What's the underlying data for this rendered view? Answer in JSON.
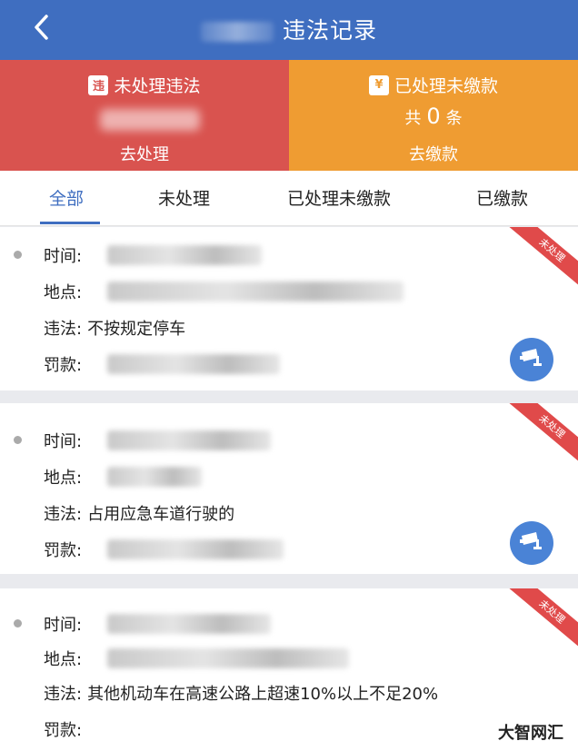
{
  "header": {
    "title": "违法记录"
  },
  "summary": {
    "unprocessed": {
      "icon_text": "违",
      "label": "未处理违法",
      "action": "去处理"
    },
    "processed_unpaid": {
      "icon_text": "¥",
      "label": "已处理未缴款",
      "count_prefix": "共",
      "count": "0",
      "count_suffix": "条",
      "action": "去缴款"
    }
  },
  "tabs": [
    "全部",
    "未处理",
    "已处理未缴款",
    "已缴款"
  ],
  "records": [
    {
      "labels": [
        "时间:",
        "地点:",
        "违法:",
        "罚款:"
      ],
      "violation": "不按规定停车",
      "status": "未处理"
    },
    {
      "labels": [
        "时间:",
        "地点:",
        "违法:",
        "罚款:"
      ],
      "violation": "占用应急车道行驶的",
      "status": "未处理"
    },
    {
      "labels": [
        "时间:",
        "地点:",
        "违法:",
        "罚款:"
      ],
      "violation": "其他机动车在高速公路上超速10%以上不足20%",
      "status": "未处理"
    }
  ],
  "watermark": "大智网汇",
  "colors": {
    "primary": "#3f6ec0",
    "red_card": "#d9534f",
    "orange_card": "#ef9c32",
    "ribbon": "#e04a4a"
  }
}
